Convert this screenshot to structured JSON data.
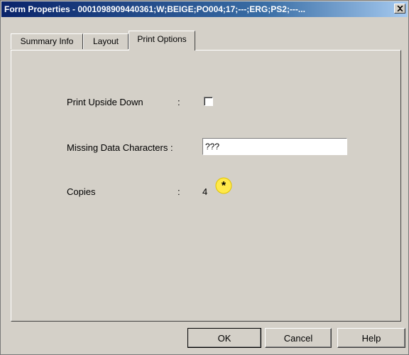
{
  "window": {
    "title": "Form Properties - 0001098909440361;W;BEIGE;PO004;17;---;ERG;PS2;---..."
  },
  "tabs": [
    {
      "label": "Summary Info",
      "active": false
    },
    {
      "label": "Layout",
      "active": false
    },
    {
      "label": "Print Options",
      "active": true
    }
  ],
  "print_options": {
    "upside_down_label": "Print Upside Down",
    "upside_down_checked": false,
    "missing_data_label": "Missing Data Characters :",
    "missing_data_value": "???",
    "copies_label": "Copies",
    "copies_value": "4",
    "colon": ":",
    "badge_symbol": "*"
  },
  "buttons": {
    "ok": "OK",
    "cancel": "Cancel",
    "help": "Help"
  },
  "colors": {
    "title_gradient_start": "#0a246a",
    "title_gradient_end": "#a6caf0",
    "dialog_face": "#d4d0c8",
    "badge_fill": "#ffe94a"
  },
  "icons": {
    "close": "close-icon",
    "badge": "star-badge-icon"
  }
}
